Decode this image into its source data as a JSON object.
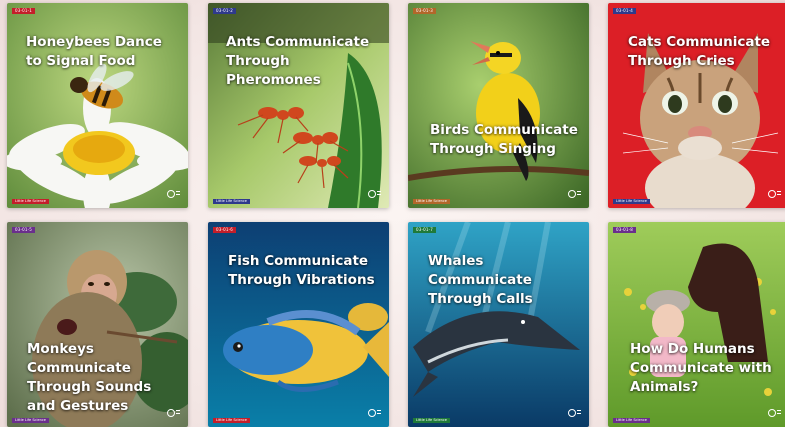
{
  "books": [
    {
      "tag": "03-01-1",
      "title": "Honeybees Dance\nto Signal Food",
      "series": "Little Life Science",
      "tag_color": "#c41e2a"
    },
    {
      "tag": "03-01-2",
      "title": "Ants Communicate\nThrough Pheromones",
      "series": "Little Life Science",
      "tag_color": "#2f3a8c"
    },
    {
      "tag": "03-01-3",
      "title": "Birds Communicate\nThrough Singing",
      "series": "Little Life Science",
      "tag_color": "#b2672a"
    },
    {
      "tag": "03-01-4",
      "title": "Cats Communicate\nThrough Cries",
      "series": "Little Life Science",
      "tag_color": "#2f3a8c"
    },
    {
      "tag": "03-01-5",
      "title": "Monkeys Communicate\nThrough Sounds\nand Gestures",
      "series": "Little Life Science",
      "tag_color": "#6a2f8c"
    },
    {
      "tag": "03-01-6",
      "title": "Fish Communicate\nThrough Vibrations",
      "series": "Little Life Science",
      "tag_color": "#c41e2a"
    },
    {
      "tag": "03-01-7",
      "title": "Whales Communicate\nThrough Calls",
      "series": "Little Life Science",
      "tag_color": "#1f7a3a"
    },
    {
      "tag": "03-01-8",
      "title": "How Do Humans\nCommunicate with\nAnimals?",
      "series": "Little Life Science",
      "tag_color": "#6a2f8c"
    }
  ]
}
